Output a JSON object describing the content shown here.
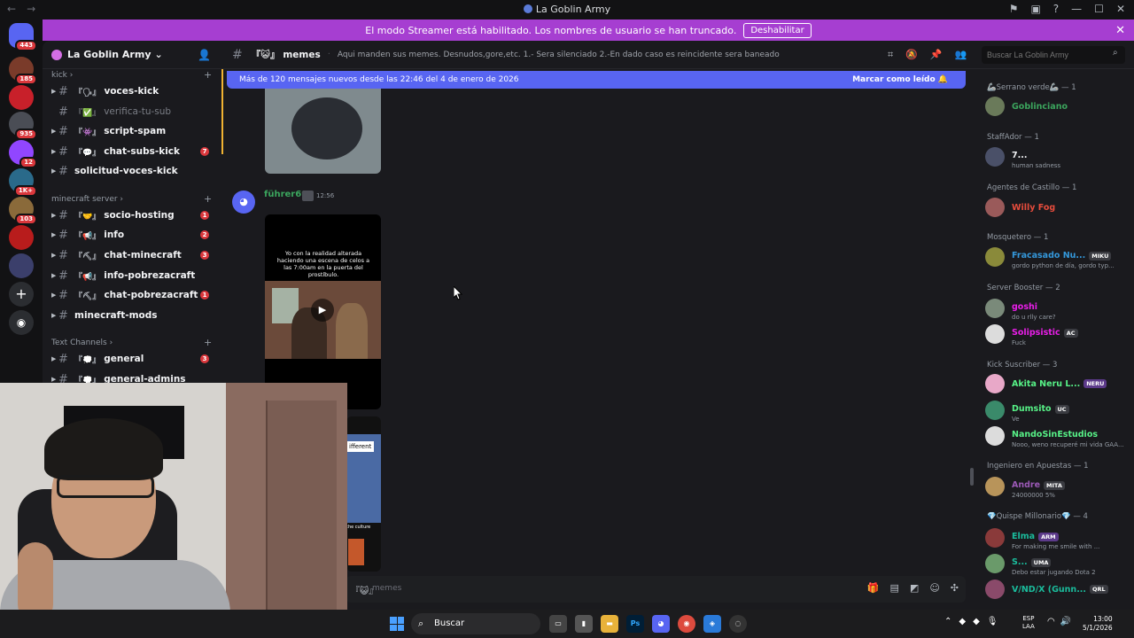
{
  "window": {
    "title": "La Goblin Army"
  },
  "banner": {
    "text": "El modo Streamer está habilitado. Los nombres de usuario se han truncado.",
    "button": "Deshabilitar"
  },
  "servers": [
    {
      "badge": "443"
    },
    {
      "badge": "185"
    },
    {
      "badge": ""
    },
    {
      "badge": "935"
    },
    {
      "badge": "12"
    },
    {
      "badge": "1K+"
    },
    {
      "badge": "103"
    },
    {
      "badge": ""
    },
    {
      "badge": ""
    }
  ],
  "guild": {
    "name": "La Goblin Army"
  },
  "categories": {
    "kick": "kick",
    "minecraft": "minecraft server",
    "text": "Text Channels"
  },
  "channels": [
    {
      "name": "voces-kick",
      "emoji": "『🗣』",
      "count": ""
    },
    {
      "name": "verifica-tu-sub",
      "emoji": "『✅』",
      "count": ""
    },
    {
      "name": "script-spam",
      "emoji": "『👾』",
      "count": ""
    },
    {
      "name": "chat-subs-kick",
      "emoji": "『💬』",
      "count": "7"
    },
    {
      "name": "solicitud-voces-kick",
      "emoji": "",
      "count": ""
    },
    {
      "name": "socio-hosting",
      "emoji": "『🤝』",
      "count": "1"
    },
    {
      "name": "info",
      "emoji": "『📢』",
      "count": "2"
    },
    {
      "name": "chat-minecraft",
      "emoji": "『⛏』",
      "count": "3"
    },
    {
      "name": "info-pobrezacraft",
      "emoji": "『📢』",
      "count": ""
    },
    {
      "name": "chat-pobrezacraft",
      "emoji": "『⛏』",
      "count": "1"
    },
    {
      "name": "minecraft-mods",
      "emoji": "",
      "count": ""
    },
    {
      "name": "general",
      "emoji": "『💭』",
      "count": "3"
    },
    {
      "name": "general-admins",
      "emoji": "『💭』",
      "count": ""
    }
  ],
  "topbar": {
    "channel": "『😺』 memes",
    "topic": "Aqui manden sus memes. Desnudos,gore,etc. 1.- Sera silenciado 2.-En dado caso es reincidente sera baneado",
    "search_placeholder": "Buscar La Goblin Army"
  },
  "chat": {
    "new_messages": "Más de 120 mensajes nuevos desde las 22:46 del 4 de enero de 2026",
    "mark_read": "Marcar como leído",
    "message": {
      "author": "führer69",
      "time": "12:56",
      "video_caption": "Yo con la realidad alterada haciendo una escena de celos a las 7:00am en la puerta del prostíbulo.",
      "image_tag": "ifferent",
      "image_sub": "the culture"
    },
    "input_placeholder": "memes",
    "input_prefix": "『😺』"
  },
  "members": {
    "groups": [
      {
        "label": "🦾Serrano verde🦾 — 1"
      },
      {
        "label": "StaffAdor — 1"
      },
      {
        "label": "Agentes de Castillo — 1"
      },
      {
        "label": "Mosquetero — 1"
      },
      {
        "label": "Server Booster — 2"
      },
      {
        "label": "Kick Suscriber — 3"
      },
      {
        "label": "Ingeniero en Apuestas — 1"
      },
      {
        "label": "💎Quispe Millonario💎 — 4"
      }
    ],
    "list": [
      {
        "name": "Goblinciano",
        "status": "",
        "chip": "",
        "color": "#3ba55d"
      },
      {
        "name": "7...",
        "status": "human sadness",
        "chip": "",
        "color": "#f2f3f5"
      },
      {
        "name": "Willy Fog",
        "status": "",
        "chip": "",
        "color": "#e74c3c"
      },
      {
        "name": "Fracasado Nu...",
        "status": "gordo python de día, gordo typ...",
        "chip": "MIKU",
        "color": "#3498db"
      },
      {
        "name": "goshi",
        "status": "do u rlly care?",
        "chip": "",
        "color": "#e91ee8"
      },
      {
        "name": "Solipsistic",
        "status": "Fuck",
        "chip": "AC",
        "color": "#e91ee8"
      },
      {
        "name": "Akita Neru L...",
        "status": "",
        "chip": "NERU",
        "color": "#57f287"
      },
      {
        "name": "Dumsito",
        "status": "Ve",
        "chip": "UC",
        "color": "#57f287"
      },
      {
        "name": "NandoSinEstudios",
        "status": "Nooo, weno recuperé mi vida GAA...",
        "chip": "",
        "color": "#57f287"
      },
      {
        "name": "Andre",
        "status": "24000000 5%",
        "chip": "MITA",
        "color": "#9b59b6"
      },
      {
        "name": "Elma",
        "status": "For making me smile with ...",
        "chip": "ARM",
        "color": "#1abc9c"
      },
      {
        "name": "S...",
        "status": "Debo estar jugando Dota 2",
        "chip": "UMA",
        "color": "#1abc9c"
      },
      {
        "name": "V/ND/X (Gunn...",
        "status": "",
        "chip": "QRL",
        "color": "#1abc9c"
      }
    ]
  },
  "taskbar": {
    "search": "Buscar",
    "lang_1": "ESP",
    "lang_2": "LAA",
    "time": "13:00",
    "date": "5/1/2026"
  }
}
